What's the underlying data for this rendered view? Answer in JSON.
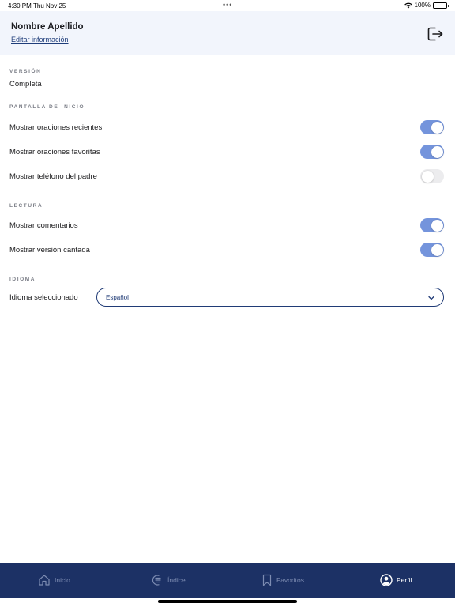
{
  "status_bar": {
    "time": "4:30 PM",
    "date": "Thu Nov 25",
    "battery": "100%"
  },
  "header": {
    "user_name": "Nombre Apellido",
    "edit_link": "Editar información"
  },
  "sections": {
    "version": {
      "label": "VERSIÓN",
      "value": "Completa"
    },
    "home_screen": {
      "label": "PANTALLA DE INICIO",
      "rows": [
        {
          "label": "Mostrar oraciones recientes",
          "on": true
        },
        {
          "label": "Mostrar oraciones favoritas",
          "on": true
        },
        {
          "label": "Mostrar teléfono del padre",
          "on": false
        }
      ]
    },
    "reading": {
      "label": "LECTURA",
      "rows": [
        {
          "label": "Mostrar comentarios",
          "on": true
        },
        {
          "label": "Mostrar versión cantada",
          "on": true
        }
      ]
    },
    "language": {
      "label": "IDIOMA",
      "row_label": "Idioma seleccionado",
      "selected": "Español"
    }
  },
  "tabs": [
    {
      "label": "Inicio",
      "icon": "home-icon",
      "active": false
    },
    {
      "label": "Índice",
      "icon": "index-list-icon",
      "active": false
    },
    {
      "label": "Favoritos",
      "icon": "bookmark-icon",
      "active": false
    },
    {
      "label": "Perfil",
      "icon": "profile-icon",
      "active": true
    }
  ],
  "colors": {
    "accent": "#7494dc",
    "primary": "#1c3165",
    "header_bg": "#f2f5fc"
  }
}
